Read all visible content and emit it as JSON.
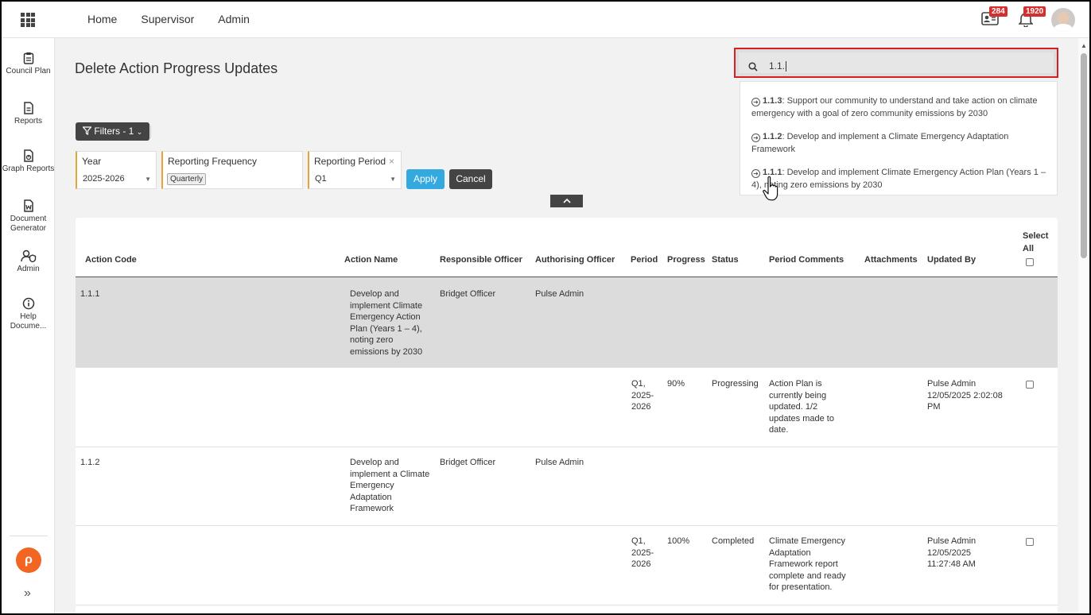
{
  "topbar": {
    "nav": [
      "Home",
      "Supervisor",
      "Admin"
    ],
    "contacts_badge": "284",
    "notifications_badge": "1920"
  },
  "sidebar": {
    "items": [
      {
        "label": "Council Plan",
        "icon": "clipboard-icon"
      },
      {
        "label": "Reports",
        "icon": "document-icon"
      },
      {
        "label": "Graph Reports",
        "icon": "graph-document-icon"
      },
      {
        "label": "Document Generator",
        "icon": "word-document-icon"
      },
      {
        "label": "Admin",
        "icon": "user-shield-icon"
      },
      {
        "label": "Help Docume...",
        "icon": "info-icon"
      }
    ],
    "logo": "ρ",
    "expand": "»"
  },
  "page": {
    "title": "Delete Action Progress Updates"
  },
  "filters": {
    "button_label": "Filters - 1",
    "year_label": "Year",
    "year_value": "2025-2026",
    "frequency_label": "Reporting Frequency",
    "frequency_chip": "Quarterly",
    "period_label": "Reporting Period",
    "period_value": "Q1",
    "apply": "Apply",
    "cancel": "Cancel"
  },
  "search": {
    "value": "1.1.",
    "suggestions": [
      {
        "code": "1.1.3",
        "text": ": Support our community to understand and take action on climate emergency with a goal of zero community emissions by 2030"
      },
      {
        "code": "1.1.2",
        "text": ": Develop and implement a Climate Emergency Adaptation Framework"
      },
      {
        "code": "1.1.1",
        "text": ": Develop and implement Climate Emergency Action Plan (Years 1 – 4), noting zero emissions by 2030"
      }
    ]
  },
  "table": {
    "columns": {
      "action_code": "Action Code",
      "action_name": "Action Name",
      "responsible": "Responsible Officer",
      "authorising": "Authorising Officer",
      "period": "Period",
      "progress": "Progress",
      "status": "Status",
      "comments": "Period Comments",
      "attachments": "Attachments",
      "updated_by": "Updated By",
      "select_all": "Select All"
    },
    "actions": [
      {
        "code": "1.1.1",
        "name": "Develop and implement Climate Emergency Action Plan (Years 1 – 4), noting zero emissions by 2030",
        "responsible": "Bridget Officer",
        "authorising": "Pulse Admin",
        "update": {
          "period": "Q1, 2025-2026",
          "progress": "90%",
          "status": "Progressing",
          "comments": "Action Plan is currently being updated. 1/2 updates made to date.",
          "updated_by": "Pulse Admin 12/05/2025 2:02:08 PM"
        }
      },
      {
        "code": "1.1.2",
        "name": "Develop and implement a Climate Emergency Adaptation Framework",
        "responsible": "Bridget Officer",
        "authorising": "Pulse Admin",
        "update": {
          "period": "Q1, 2025-2026",
          "progress": "100%",
          "status": "Completed",
          "comments": "Climate Emergency Adaptation Framework report complete and ready for presentation.",
          "updated_by": "Pulse Admin 12/05/2025 11:27:48 AM"
        }
      }
    ]
  }
}
